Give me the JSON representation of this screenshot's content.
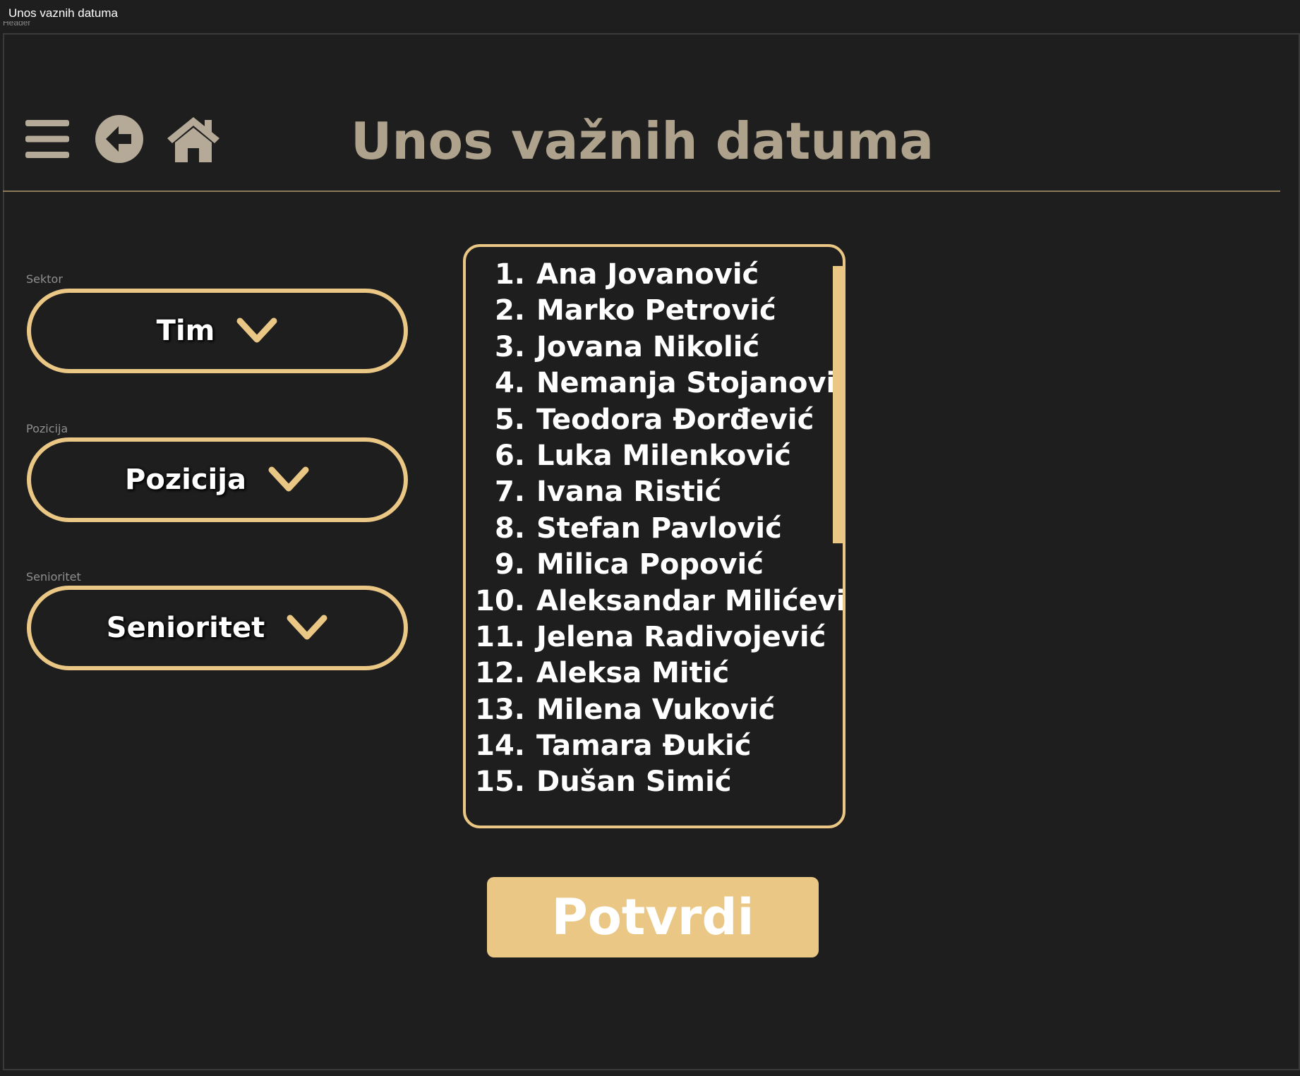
{
  "window": {
    "tab_title": "Unos vaznih datuma",
    "frame_label": "Header"
  },
  "header": {
    "title": "Unos važnih datuma",
    "icons": [
      "hamburger-menu-icon",
      "back-arrow-icon",
      "home-icon"
    ]
  },
  "filters": [
    {
      "label": "Sektor",
      "value": "Tim"
    },
    {
      "label": "Pozicija",
      "value": "Pozicija"
    },
    {
      "label": "Senioritet",
      "value": "Senioritet"
    }
  ],
  "employees": [
    {
      "num": "1.",
      "name": "Ana Jovanović"
    },
    {
      "num": "2.",
      "name": "Marko Petrović"
    },
    {
      "num": "3.",
      "name": "Jovana Nikolić"
    },
    {
      "num": "4.",
      "name": "Nemanja Stojanović"
    },
    {
      "num": "5.",
      "name": "Teodora Đorđević"
    },
    {
      "num": "6.",
      "name": "Luka Milenković"
    },
    {
      "num": "7.",
      "name": "Ivana Ristić"
    },
    {
      "num": "8.",
      "name": "Stefan Pavlović"
    },
    {
      "num": "9.",
      "name": "Milica Popović"
    },
    {
      "num": "10.",
      "name": "Aleksandar Milićević"
    },
    {
      "num": "11.",
      "name": "Jelena Radivojević"
    },
    {
      "num": "12.",
      "name": "Aleksa Mitić"
    },
    {
      "num": "13.",
      "name": "Milena Vuković"
    },
    {
      "num": "14.",
      "name": "Tamara Đukić"
    },
    {
      "num": "15.",
      "name": "Dušan Simić"
    }
  ],
  "confirm_label": "Potvrdi",
  "colors": {
    "background": "#1e1e1e",
    "accent": "#ebc785",
    "title": "#aea28c",
    "icon": "#b5aa97",
    "text": "#ffffff"
  }
}
